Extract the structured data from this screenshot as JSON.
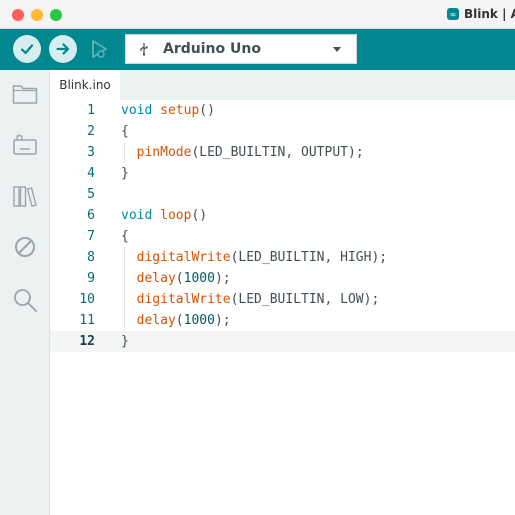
{
  "window": {
    "title": "Blink | A"
  },
  "toolbar": {
    "board_name": "Arduino Uno",
    "icons": {
      "verify": "checkmark-icon",
      "upload": "arrow-right-icon",
      "debug": "debug-play-icon",
      "usb": "usb-icon",
      "dropdown": "chevron-down-icon"
    },
    "accent": "#00878f"
  },
  "sidebar": {
    "items": [
      "folder-icon",
      "board-icon",
      "library-icon",
      "debug-stop-icon",
      "search-icon"
    ]
  },
  "tabs": [
    {
      "label": "Blink.ino"
    }
  ],
  "editor": {
    "active_line": 12,
    "lines": [
      {
        "num": "1",
        "tokens": [
          {
            "t": "void",
            "c": "kw"
          },
          {
            "t": " ",
            "c": "plain"
          },
          {
            "t": "setup",
            "c": "fn"
          },
          {
            "t": "()",
            "c": "plain"
          }
        ]
      },
      {
        "num": "2",
        "tokens": [
          {
            "t": "{",
            "c": "plain"
          }
        ]
      },
      {
        "num": "3",
        "indent": true,
        "tokens": [
          {
            "t": "  ",
            "c": "plain"
          },
          {
            "t": "pinMode",
            "c": "fn"
          },
          {
            "t": "(LED_BUILTIN, OUTPUT);",
            "c": "plain"
          }
        ]
      },
      {
        "num": "4",
        "tokens": [
          {
            "t": "}",
            "c": "plain"
          }
        ]
      },
      {
        "num": "5",
        "tokens": []
      },
      {
        "num": "6",
        "tokens": [
          {
            "t": "void",
            "c": "kw"
          },
          {
            "t": " ",
            "c": "plain"
          },
          {
            "t": "loop",
            "c": "fn"
          },
          {
            "t": "()",
            "c": "plain"
          }
        ]
      },
      {
        "num": "7",
        "tokens": [
          {
            "t": "{",
            "c": "plain"
          }
        ]
      },
      {
        "num": "8",
        "indent": true,
        "tokens": [
          {
            "t": "  ",
            "c": "plain"
          },
          {
            "t": "digitalWrite",
            "c": "fn"
          },
          {
            "t": "(LED_BUILTIN, HIGH);",
            "c": "plain"
          }
        ]
      },
      {
        "num": "9",
        "indent": true,
        "tokens": [
          {
            "t": "  ",
            "c": "plain"
          },
          {
            "t": "delay",
            "c": "fn"
          },
          {
            "t": "(",
            "c": "plain"
          },
          {
            "t": "1000",
            "c": "num"
          },
          {
            "t": ");",
            "c": "plain"
          }
        ]
      },
      {
        "num": "10",
        "indent": true,
        "tokens": [
          {
            "t": "  ",
            "c": "plain"
          },
          {
            "t": "digitalWrite",
            "c": "fn"
          },
          {
            "t": "(LED_BUILTIN, LOW);",
            "c": "plain"
          }
        ]
      },
      {
        "num": "11",
        "indent": true,
        "tokens": [
          {
            "t": "  ",
            "c": "plain"
          },
          {
            "t": "delay",
            "c": "fn"
          },
          {
            "t": "(",
            "c": "plain"
          },
          {
            "t": "1000",
            "c": "num"
          },
          {
            "t": ");",
            "c": "plain"
          }
        ]
      },
      {
        "num": "12",
        "tokens": [
          {
            "t": "}",
            "c": "plain"
          }
        ]
      }
    ]
  }
}
